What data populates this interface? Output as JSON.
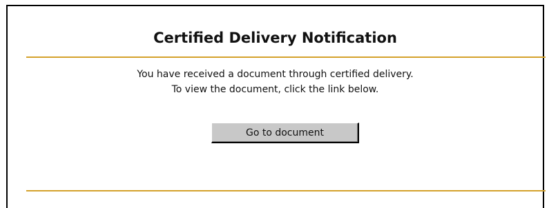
{
  "notification": {
    "title": "Certified Delivery Notification",
    "message_line1": "You have received a document through certified delivery.",
    "message_line2": "To view the document, click the link below.",
    "button_label": "Go to document"
  },
  "colors": {
    "rule": "#d4a12a",
    "button_face": "#c8c8c8",
    "border": "#000000"
  }
}
